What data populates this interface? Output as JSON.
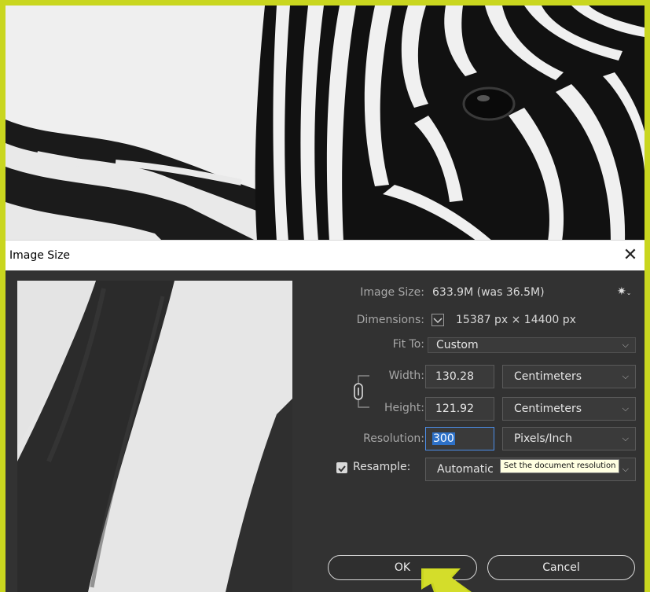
{
  "dialog": {
    "title": "Image Size",
    "close_icon": "close-icon",
    "image_size_label": "Image Size:",
    "image_size_value": "633.9M (was 36.5M)",
    "dimensions_label": "Dimensions:",
    "dimensions_value": "15387 px  ×  14400 px",
    "fit_to_label": "Fit To:",
    "fit_to_value": "Custom",
    "width_label": "Width:",
    "width_value": "130.28",
    "width_unit": "Centimeters",
    "height_label": "Height:",
    "height_value": "121.92",
    "height_unit": "Centimeters",
    "resolution_label": "Resolution:",
    "resolution_value": "300",
    "resolution_unit": "Pixels/Inch",
    "resample_label": "Resample:",
    "resample_checked": true,
    "resample_value": "Automatic",
    "tooltip": "Set the document resolution",
    "ok_label": "OK",
    "cancel_label": "Cancel"
  },
  "colors": {
    "highlight_border": "#c9d61f",
    "dialog_bg": "#323232",
    "focus_blue": "#4c8ee9"
  },
  "icons": [
    "close-icon",
    "gear-icon",
    "chevron-down-icon",
    "link-chain-icon",
    "checkbox-icon",
    "arrow-pointer"
  ]
}
